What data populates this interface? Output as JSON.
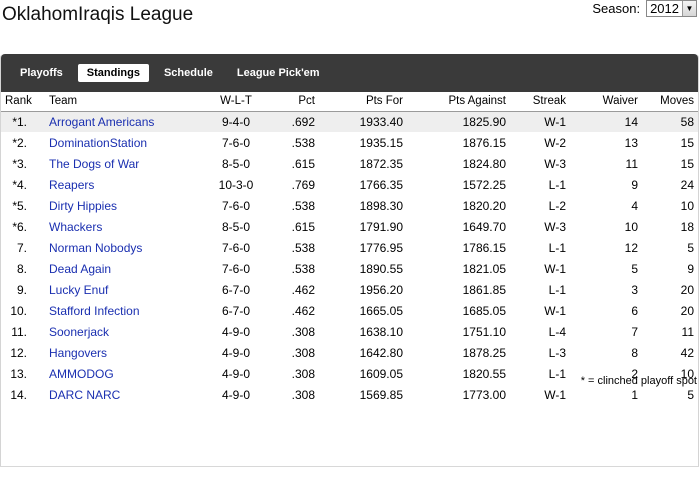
{
  "league": {
    "title": "OklahomIraqis League"
  },
  "season": {
    "label": "Season:",
    "value": "2012"
  },
  "nav": {
    "tabs": [
      {
        "label": "Playoffs",
        "active": false
      },
      {
        "label": "Standings",
        "active": true
      },
      {
        "label": "Schedule",
        "active": false
      },
      {
        "label": "League Pick'em",
        "active": false
      }
    ]
  },
  "standings": {
    "columns": [
      "Rank",
      "Team",
      "W-L-T",
      "Pct",
      "Pts For",
      "Pts Against",
      "Streak",
      "Waiver",
      "Moves"
    ],
    "rows": [
      {
        "rank": "*1.",
        "team": "Arrogant Americans",
        "wlt": "9-4-0",
        "pct": ".692",
        "pts_for": "1933.40",
        "pts_against": "1825.90",
        "streak": "W-1",
        "waiver": "14",
        "moves": "58"
      },
      {
        "rank": "*2.",
        "team": "DominationStation",
        "wlt": "7-6-0",
        "pct": ".538",
        "pts_for": "1935.15",
        "pts_against": "1876.15",
        "streak": "W-2",
        "waiver": "13",
        "moves": "15"
      },
      {
        "rank": "*3.",
        "team": "The Dogs of War",
        "wlt": "8-5-0",
        "pct": ".615",
        "pts_for": "1872.35",
        "pts_against": "1824.80",
        "streak": "W-3",
        "waiver": "11",
        "moves": "15"
      },
      {
        "rank": "*4.",
        "team": "Reapers",
        "wlt": "10-3-0",
        "pct": ".769",
        "pts_for": "1766.35",
        "pts_against": "1572.25",
        "streak": "L-1",
        "waiver": "9",
        "moves": "24"
      },
      {
        "rank": "*5.",
        "team": "Dirty Hippies",
        "wlt": "7-6-0",
        "pct": ".538",
        "pts_for": "1898.30",
        "pts_against": "1820.20",
        "streak": "L-2",
        "waiver": "4",
        "moves": "10"
      },
      {
        "rank": "*6.",
        "team": "Whackers",
        "wlt": "8-5-0",
        "pct": ".615",
        "pts_for": "1791.90",
        "pts_against": "1649.70",
        "streak": "W-3",
        "waiver": "10",
        "moves": "18"
      },
      {
        "rank": "7.",
        "team": "Norman Nobodys",
        "wlt": "7-6-0",
        "pct": ".538",
        "pts_for": "1776.95",
        "pts_against": "1786.15",
        "streak": "L-1",
        "waiver": "12",
        "moves": "5"
      },
      {
        "rank": "8.",
        "team": "Dead Again",
        "wlt": "7-6-0",
        "pct": ".538",
        "pts_for": "1890.55",
        "pts_against": "1821.05",
        "streak": "W-1",
        "waiver": "5",
        "moves": "9"
      },
      {
        "rank": "9.",
        "team": "Lucky Enuf",
        "wlt": "6-7-0",
        "pct": ".462",
        "pts_for": "1956.20",
        "pts_against": "1861.85",
        "streak": "L-1",
        "waiver": "3",
        "moves": "20"
      },
      {
        "rank": "10.",
        "team": "Stafford Infection",
        "wlt": "6-7-0",
        "pct": ".462",
        "pts_for": "1665.05",
        "pts_against": "1685.05",
        "streak": "W-1",
        "waiver": "6",
        "moves": "20"
      },
      {
        "rank": "11.",
        "team": "Soonerjack",
        "wlt": "4-9-0",
        "pct": ".308",
        "pts_for": "1638.10",
        "pts_against": "1751.10",
        "streak": "L-4",
        "waiver": "7",
        "moves": "11"
      },
      {
        "rank": "12.",
        "team": "Hangovers",
        "wlt": "4-9-0",
        "pct": ".308",
        "pts_for": "1642.80",
        "pts_against": "1878.25",
        "streak": "L-3",
        "waiver": "8",
        "moves": "42"
      },
      {
        "rank": "13.",
        "team": "AMMODOG",
        "wlt": "4-9-0",
        "pct": ".308",
        "pts_for": "1609.05",
        "pts_against": "1820.55",
        "streak": "L-1",
        "waiver": "2",
        "moves": "10"
      },
      {
        "rank": "14.",
        "team": "DARC NARC",
        "wlt": "4-9-0",
        "pct": ".308",
        "pts_for": "1569.85",
        "pts_against": "1773.00",
        "streak": "W-1",
        "waiver": "1",
        "moves": "5"
      }
    ],
    "footnote": "* = clinched playoff spot"
  },
  "colors": {
    "navbar": "#3a3a3a",
    "link": "#1a2fb0",
    "highlight_row": "#eeeeee"
  }
}
